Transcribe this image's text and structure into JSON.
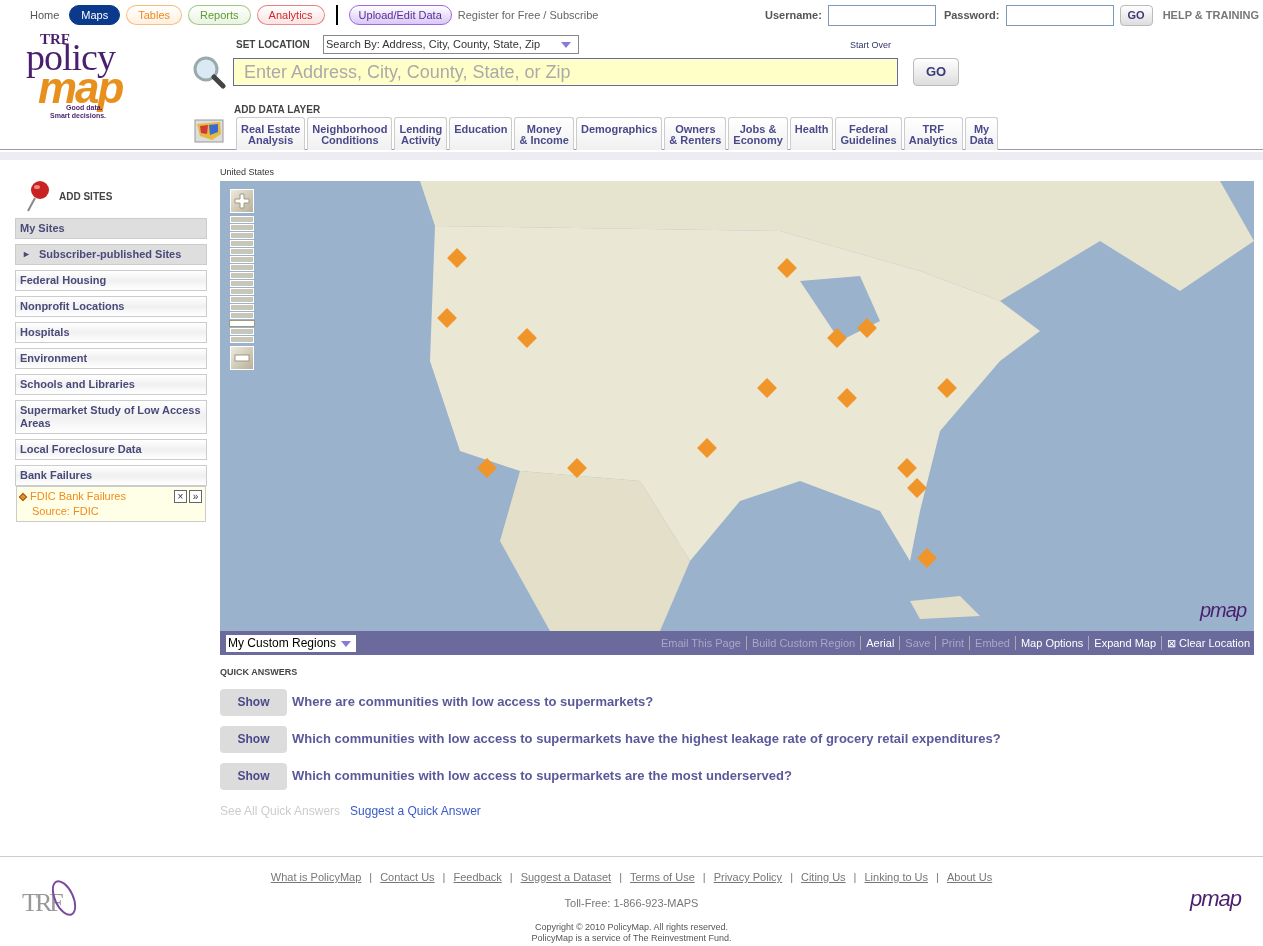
{
  "top_nav": [
    {
      "label": "Home",
      "selected": false,
      "color": "#ffffff"
    },
    {
      "label": "Maps",
      "selected": true,
      "color": "#0b3a8c"
    },
    {
      "label": "Tables",
      "selected": false,
      "color": "#f08a1c"
    },
    {
      "label": "Reports",
      "selected": false,
      "color": "#5aa02c"
    },
    {
      "label": "Analytics",
      "selected": false,
      "color": "#d42a2a"
    }
  ],
  "upload_button": "Upload/Edit Data",
  "register_link": "Register for Free / Subscribe",
  "login": {
    "username_label": "Username:",
    "password_label": "Password:",
    "go": "GO",
    "help": "HELP & TRAINING"
  },
  "logo": {
    "brand": "TRF",
    "line1": "policy",
    "line2": "map",
    "tagline1": "Good data.",
    "tagline2": "Smart decisions."
  },
  "set_location": {
    "label": "SET LOCATION",
    "search_by": "Search By: Address, City, County, State, Zip",
    "start_over": "Start Over",
    "placeholder": "Enter Address, City, County, State, or Zip",
    "go": "GO"
  },
  "data_layer": {
    "label": "ADD DATA LAYER",
    "tabs": [
      {
        "lines": [
          "Real Estate",
          "Analysis"
        ]
      },
      {
        "lines": [
          "Neighborhood",
          "Conditions"
        ]
      },
      {
        "lines": [
          "Lending",
          "Activity"
        ]
      },
      {
        "lines": [
          "Education"
        ]
      },
      {
        "lines": [
          "Money",
          "& Income"
        ]
      },
      {
        "lines": [
          "Demographics"
        ]
      },
      {
        "lines": [
          "Owners",
          "& Renters"
        ]
      },
      {
        "lines": [
          "Jobs &",
          "Economy"
        ]
      },
      {
        "lines": [
          "Health"
        ]
      },
      {
        "lines": [
          "Federal",
          "Guidelines"
        ]
      },
      {
        "lines": [
          "TRF",
          "Analytics"
        ]
      },
      {
        "lines": [
          "My",
          "Data"
        ]
      }
    ]
  },
  "sidebar": {
    "title": "ADD SITES",
    "items": [
      {
        "label": "My Sites",
        "highlighted": true
      },
      {
        "label": "Subscriber-published Sites",
        "highlighted": true,
        "marker": "►"
      },
      {
        "label": "Federal Housing",
        "highlighted": false
      },
      {
        "label": "Nonprofit Locations",
        "highlighted": false
      },
      {
        "label": "Hospitals",
        "highlighted": false
      },
      {
        "label": "Environment",
        "highlighted": false
      },
      {
        "label": "Schools and Libraries",
        "highlighted": false
      },
      {
        "label": "Supermarket Study of Low Access Areas",
        "highlighted": false
      },
      {
        "label": "Local Foreclosure Data",
        "highlighted": false
      },
      {
        "label": "Bank Failures",
        "highlighted": false,
        "layers": [
          {
            "name": "FDIC Bank Failures",
            "source": "Source: FDIC",
            "remove": "×",
            "more": "»"
          }
        ]
      }
    ]
  },
  "map": {
    "breadcrumb": "United States",
    "kind": "picture",
    "zoom": {
      "level": 0.13
    },
    "corner_logo": "pmap",
    "region_select": "My Custom Regions",
    "toolbar": [
      {
        "label": "Email This Page",
        "disabled": true
      },
      {
        "label": "Build Custom Region",
        "disabled": true
      },
      {
        "label": "Aerial",
        "disabled": false
      },
      {
        "label": "Save",
        "disabled": true
      },
      {
        "label": "Print",
        "disabled": true
      },
      {
        "label": "Embed",
        "disabled": true
      },
      {
        "label": "Map Options",
        "disabled": false
      },
      {
        "label": "Expand Map",
        "disabled": false
      },
      {
        "label": "Clear Location",
        "disabled": false,
        "icon": "⊠"
      }
    ]
  },
  "quick_answers": {
    "title": "QUICK ANSWERS",
    "items": [
      {
        "button": "Show",
        "question": "Where are communities with low access to supermarkets?"
      },
      {
        "button": "Show",
        "question": "Which communities with low access to supermarkets have the highest leakage rate of grocery retail expenditures?"
      },
      {
        "button": "Show",
        "question": "Which communities with low access to supermarkets are the most underserved?"
      }
    ],
    "links": [
      {
        "label": "See All Quick Answers",
        "disabled": true
      },
      {
        "label": "Suggest a Quick Answer",
        "disabled": false
      }
    ]
  },
  "footer": {
    "logo": "TRF",
    "links": [
      "What is PolicyMap",
      "Contact Us",
      "Feedback",
      "Suggest a Dataset",
      "Terms of Use",
      "Privacy Policy",
      "Citing Us",
      "Linking to Us",
      "About Us"
    ],
    "separator": "|",
    "phone": "Toll-Free: 1-866-923-MAPS",
    "copyright": "Copyright © 2010 PolicyMap. All rights reserved.",
    "service": "PolicyMap is a service of The Reinvestment Fund.",
    "right_logo": "pmap"
  }
}
